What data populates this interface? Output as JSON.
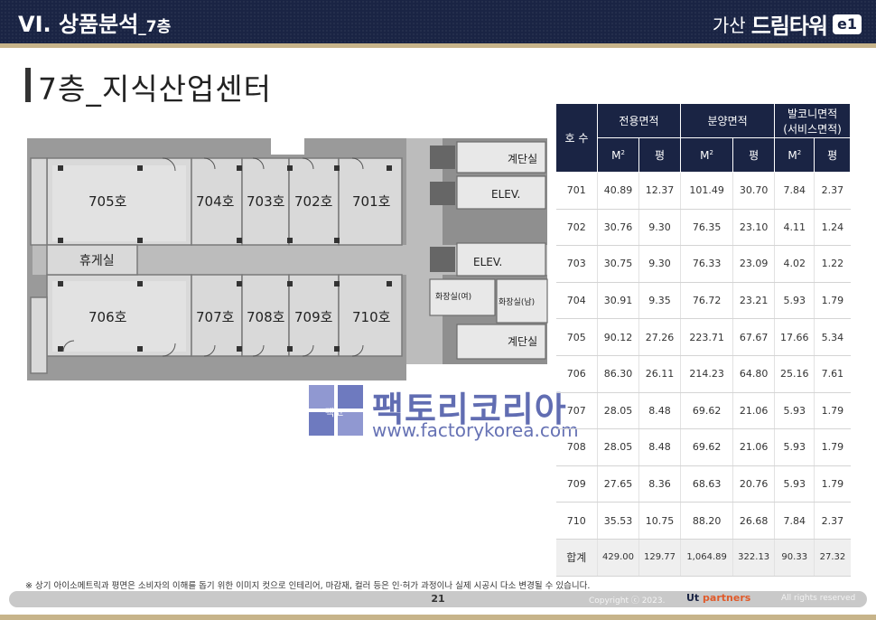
{
  "header": {
    "title": "VI. 상품분석",
    "title_sub": "_7층",
    "brand_location": "가산",
    "brand_name": "드림타워",
    "brand_badge": "e1"
  },
  "section": {
    "title": "7층_지식산업센터"
  },
  "floor_plan": {
    "rooms": [
      "705호",
      "704호",
      "703호",
      "702호",
      "701호",
      "706호",
      "707호",
      "708호",
      "709호",
      "710호"
    ],
    "lounge": "휴게실",
    "stairs_top": "계단실",
    "stairs_bottom": "계단실",
    "elev_top": "ELEV.",
    "elev_mid": "ELEV.",
    "restroom_f": "화장실(여)",
    "restroom_m": "화장실(남)"
  },
  "watermark": {
    "logo_text": "팩코",
    "title": "팩토리코리아",
    "url": "www.factorykorea.com"
  },
  "table": {
    "headers": {
      "unit": "호 수",
      "exclusive": "전용면적",
      "sale": "분양면적",
      "balcony": "발코니면적",
      "balcony_sub": "(서비스면적)",
      "m2": "M",
      "m2_sup": "2",
      "pyeong": "평"
    },
    "rows": [
      [
        "701",
        "40.89",
        "12.37",
        "101.49",
        "30.70",
        "7.84",
        "2.37"
      ],
      [
        "702",
        "30.76",
        "9.30",
        "76.35",
        "23.10",
        "4.11",
        "1.24"
      ],
      [
        "703",
        "30.75",
        "9.30",
        "76.33",
        "23.09",
        "4.02",
        "1.22"
      ],
      [
        "704",
        "30.91",
        "9.35",
        "76.72",
        "23.21",
        "5.93",
        "1.79"
      ],
      [
        "705",
        "90.12",
        "27.26",
        "223.71",
        "67.67",
        "17.66",
        "5.34"
      ],
      [
        "706",
        "86.30",
        "26.11",
        "214.23",
        "64.80",
        "25.16",
        "7.61"
      ],
      [
        "707",
        "28.05",
        "8.48",
        "69.62",
        "21.06",
        "5.93",
        "1.79"
      ],
      [
        "708",
        "28.05",
        "8.48",
        "69.62",
        "21.06",
        "5.93",
        "1.79"
      ],
      [
        "709",
        "27.65",
        "8.36",
        "68.63",
        "20.76",
        "5.93",
        "1.79"
      ],
      [
        "710",
        "35.53",
        "10.75",
        "88.20",
        "26.68",
        "7.84",
        "2.37"
      ]
    ],
    "total": [
      "합계",
      "429.00",
      "129.77",
      "1,064.89",
      "322.13",
      "90.33",
      "27.32"
    ]
  },
  "note": "※ 상기 아이소메트릭과 평면은 소비자의 이해를 돕기 위한 이미지 컷으로 인테리어, 마감재, 컬러 등은 인·허가 과정이나 실제 시공시 다소 변경될 수 있습니다.",
  "footer": {
    "page": "21",
    "copyright": "Copyright ⓒ 2023.",
    "partner": "Ut",
    "partner_name": "partners",
    "rights": "All rights reserved"
  },
  "colors": {
    "navy": "#1a2444",
    "gold": "#c7b48a",
    "footer_gray": "#c9c9c9"
  }
}
